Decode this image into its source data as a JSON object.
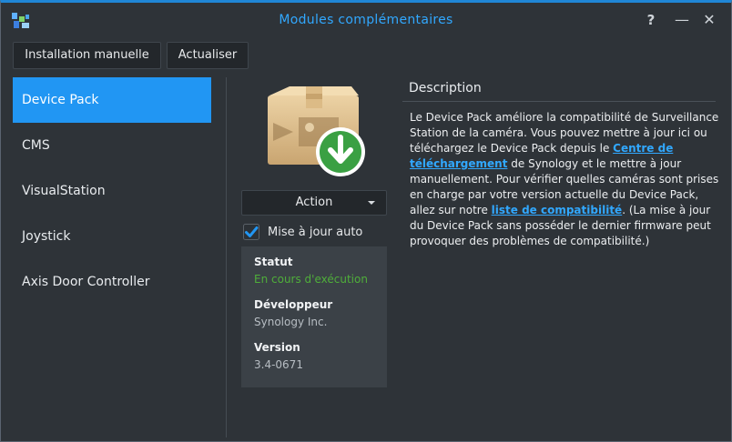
{
  "window": {
    "title": "Modules complémentaires",
    "accent_color": "#1f86d6",
    "title_color": "#31a8ff",
    "controls": {
      "help": "?",
      "minimize": "—",
      "close": "✕"
    }
  },
  "toolbar": {
    "manual_install_label": "Installation manuelle",
    "refresh_label": "Actualiser"
  },
  "sidebar": {
    "active_color": "#2196f3",
    "items": [
      {
        "label": "Device Pack",
        "active": true
      },
      {
        "label": "CMS",
        "active": false
      },
      {
        "label": "VisualStation",
        "active": false
      },
      {
        "label": "Joystick",
        "active": false
      },
      {
        "label": "Axis Door Controller",
        "active": false
      }
    ]
  },
  "package": {
    "icon": "package-box-with-download-arrow-icon",
    "action_label": "Action",
    "auto_update_label": "Mise à jour auto",
    "auto_update_checked": true,
    "status_label": "Statut",
    "status_value": "En cours d'exécution",
    "status_color": "#4fae3a",
    "developer_label": "Développeur",
    "developer_value": "Synology Inc.",
    "version_label": "Version",
    "version_value": "3.4-0671"
  },
  "description": {
    "heading": "Description",
    "text_1": "Le Device Pack améliore la compatibilité de Surveillance Station de la caméra. Vous pouvez mettre à jour ici ou téléchargez le Device Pack depuis le ",
    "link_1": "Centre de téléchargement",
    "text_2": " de Synology et le mettre à jour manuellement. Pour vérifier quelles caméras sont prises en charge par votre version actuelle du Device Pack, allez sur notre ",
    "link_2": "liste de compatibilité",
    "text_3": ". (La mise à jour du Device Pack sans posséder le dernier firmware peut provoquer des problèmes de compatibilité.)"
  }
}
